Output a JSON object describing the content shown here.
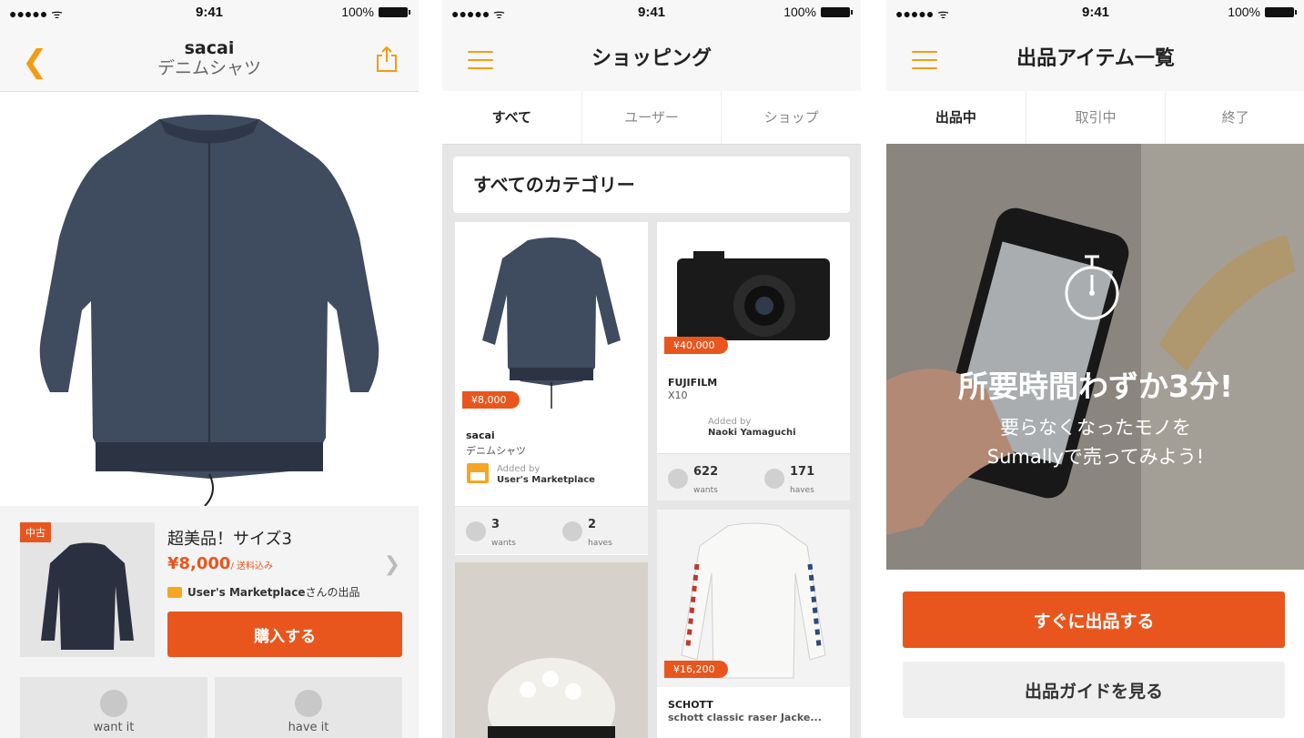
{
  "status": {
    "time": "9:41",
    "battery": "100%",
    "signal": "●●●●● ᯤ"
  },
  "screen1": {
    "brand": "sacai",
    "product_name": "デニムシャツ",
    "item": {
      "condition_tag": "中古",
      "title": "超美品！サイズ3",
      "price": "¥8,000",
      "price_note": "/ 送料込み",
      "seller": "User's Marketplace",
      "seller_suffix": "さんの出品",
      "buy_label": "購入する"
    },
    "actions": {
      "want": "want it",
      "have": "have it"
    }
  },
  "screen2": {
    "title": "ショッピング",
    "tabs": [
      "すべて",
      "ユーザー",
      "ショップ"
    ],
    "category_header": "すべてのカテゴリー",
    "cards": [
      {
        "price": "¥8,000",
        "brand": "sacai",
        "name": "デニムシャツ",
        "added_by_label": "Added by",
        "added_by": "User's Marketplace",
        "wants": "3",
        "wants_label": "wants",
        "haves": "2",
        "haves_label": "haves"
      },
      {
        "price": "¥40,000",
        "brand": "FUJIFILM",
        "name": "X10",
        "added_by_label": "Added by",
        "added_by": "Naoki Yamaguchi",
        "wants": "622",
        "wants_label": "wants",
        "haves": "171",
        "haves_label": "haves"
      },
      {
        "price": "¥16,200",
        "brand": "SCHOTT",
        "name": "schott classic raser Jacke..."
      }
    ]
  },
  "screen3": {
    "title": "出品アイテム一覧",
    "tabs": [
      "出品中",
      "取引中",
      "終了"
    ],
    "hero_title": "所要時間わずか3分!",
    "hero_line1": "要らなくなったモノを",
    "hero_line2": "Sumallyで売ってみよう!",
    "primary_cta": "すぐに出品する",
    "secondary_cta": "出品ガイドを見る"
  },
  "colors": {
    "accent": "#e8561e",
    "icon_accent": "#f39c12"
  }
}
